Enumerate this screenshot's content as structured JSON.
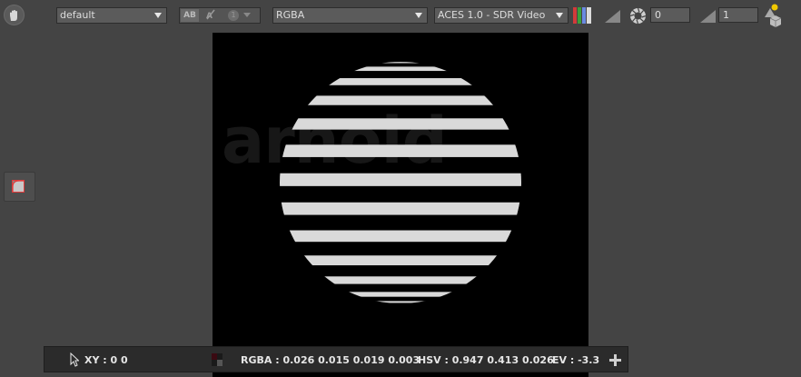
{
  "toolbar": {
    "display_preset": "default",
    "ab_label": "AB",
    "ab_slot_number": "1",
    "channel": "RGBA",
    "view_transform": "ACES 1.0 - SDR Video",
    "exposure_value": "0",
    "gamma_value": "1"
  },
  "viewport": {
    "watermark_text": "arnold"
  },
  "status": {
    "xy": "XY : 0 0",
    "rgba": "RGBA : 0.026 0.015 0.019 0.003",
    "hsv": "HSV : 0.947 0.413 0.026",
    "ev": "EV : -3.3"
  },
  "icons": {
    "pan": "hand-icon",
    "ab_compare": "ab-compare-icon",
    "ab_wipe": "wipe-icon",
    "channels": "rgb-channels-icon",
    "gamma": "gamma-ramp-icon",
    "exposure": "aperture-icon",
    "shapes": "shapes-icon",
    "region": "region-icon",
    "cursor": "cursor-icon",
    "swatch": "color-swatch-icon",
    "add": "plus-icon"
  },
  "colors": {
    "background": "#444444",
    "viewport": "#000000",
    "status_bar": "#2b2b2b",
    "stripe": "#d9d9d9",
    "accent_red": "#e03a3a",
    "shape_yellow": "#f0c800"
  }
}
